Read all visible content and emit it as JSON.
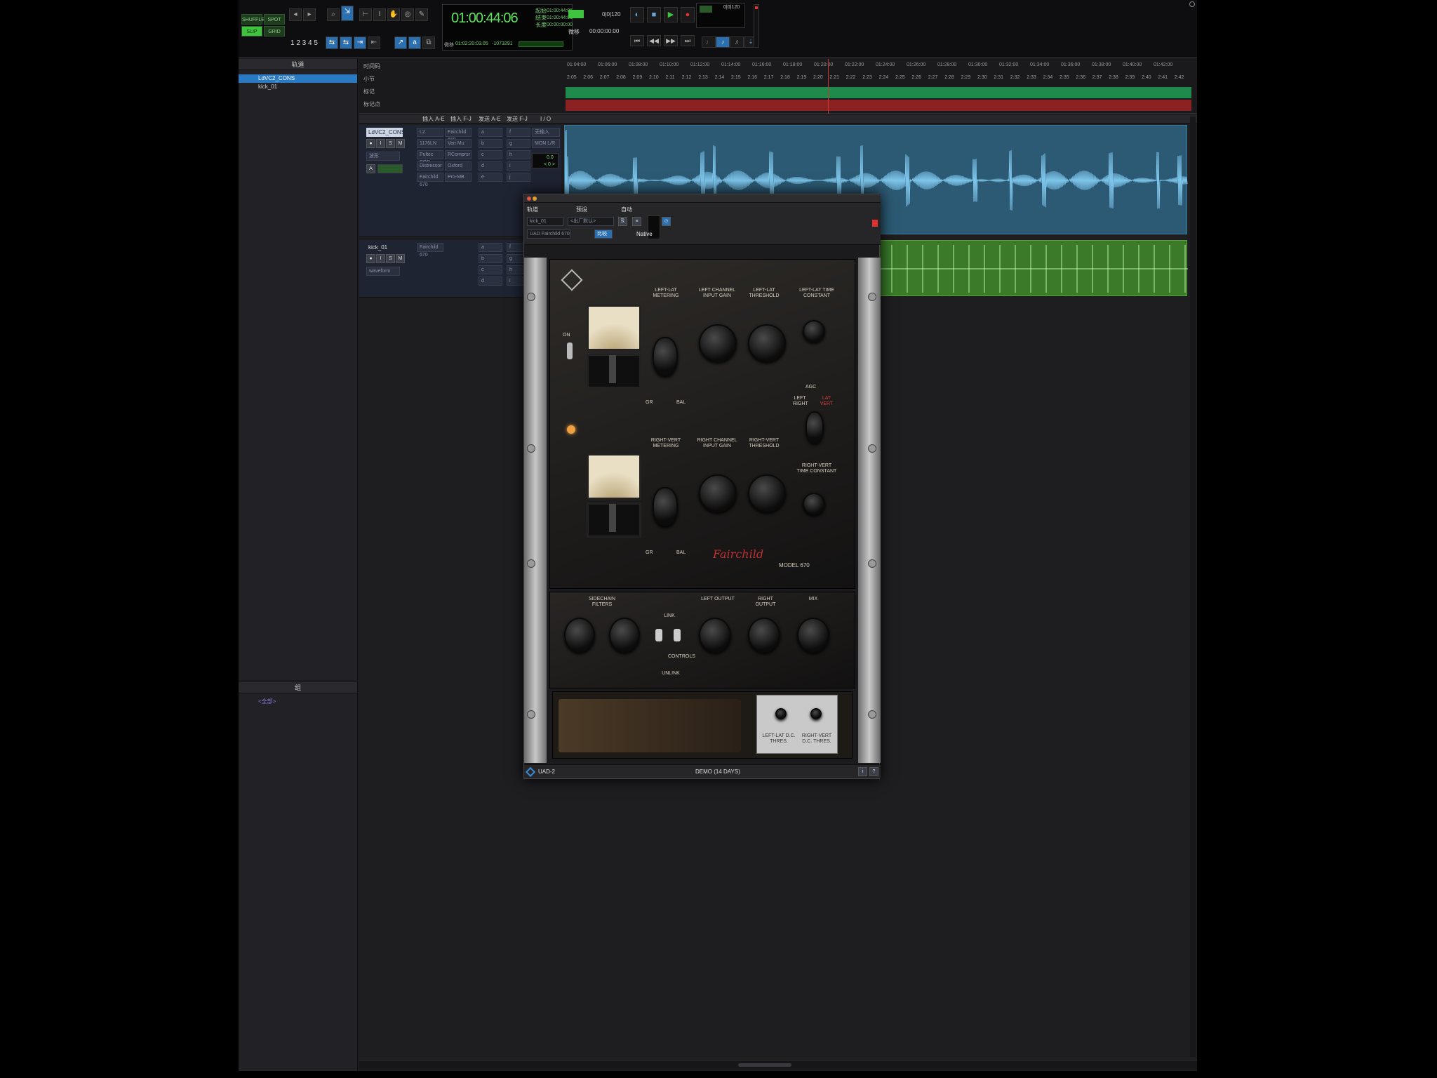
{
  "toolbar": {
    "modes": [
      "SHUFFLE",
      "SPOT",
      "SLIP",
      "GRID"
    ],
    "zoom_presets": "1 2 3 4 5",
    "main_counter": "01:00:44:06",
    "sub_counter": "01:00:44:06",
    "start_end_length": [
      "起始",
      "结束",
      "长度"
    ],
    "start_value": "01:00:44:06",
    "end_value": "01:00:44:06",
    "length_value": "00:00:00:00",
    "nudge_label": "微移",
    "nudge_value": "01:02:20:03.05",
    "cursor_value": "-1073291",
    "grid_value": "0|0|120",
    "transport_counter": "0|0|120"
  },
  "tracks_panel": {
    "title": "轨道",
    "items": [
      {
        "name": "LdVC2_CONS",
        "selected": true
      },
      {
        "name": "kick_01",
        "selected": false
      }
    ]
  },
  "groups_panel": {
    "title": "组",
    "items": [
      "<全部>"
    ]
  },
  "rulers": {
    "labels": [
      "时间码",
      "小节",
      "标记",
      "标记点"
    ],
    "timecodes": [
      "01:04:00",
      "01:06:00",
      "01:08:00",
      "01:10:00",
      "01:12:00",
      "01:14:00",
      "01:16:00",
      "01:18:00",
      "01:20:00",
      "01:22:00",
      "01:24:00",
      "01:26:00",
      "01:28:00",
      "01:30:00",
      "01:32:00",
      "01:34:00",
      "01:36:00",
      "01:38:00",
      "01:40:00",
      "01:42:00"
    ],
    "bars": [
      "2:05",
      "2:06",
      "2:07",
      "2:08",
      "2:09",
      "2:10",
      "2:11",
      "2:12",
      "2:13",
      "2:14",
      "2:15",
      "2:16",
      "2:17",
      "2:18",
      "2:19",
      "2:20",
      "2:21",
      "2:22",
      "2:23",
      "2:24",
      "2:25",
      "2:26",
      "2:27",
      "2:28",
      "2:29",
      "2:30",
      "2:31",
      "2:32",
      "2:33",
      "2:34",
      "2:35",
      "2:36",
      "2:37",
      "2:38",
      "2:39",
      "2:40",
      "2:41",
      "2:42"
    ]
  },
  "columns": [
    "插入 A-E",
    "插入 F-J",
    "发送 A-E",
    "发送 F-J",
    "I / O"
  ],
  "track1": {
    "name": "LdVC2_CONS",
    "view": "波形",
    "inserts": [
      "L2",
      "1176LN",
      "Pultec EQP",
      "Distressor",
      "Fairchild 670"
    ],
    "inserts_fj": [
      "Fairchild 660",
      "Vari Mu",
      "RComprsr",
      "Oxford",
      "Pro-MB"
    ],
    "sends": [
      "a",
      "b",
      "c",
      "d",
      "e"
    ],
    "sends_fj": [
      "f",
      "g",
      "h",
      "i",
      "j"
    ],
    "io_in": "无输入",
    "io_out": "MON L/R",
    "vol": "0.0",
    "pan": "< 0 >"
  },
  "track2": {
    "name": "kick_01",
    "view": "waveform",
    "inserts": [
      "Fairchild 670"
    ],
    "sends": [
      "a",
      "b",
      "c",
      "d"
    ],
    "sends_fj": [
      "f",
      "g",
      "h",
      "i"
    ]
  },
  "plugin": {
    "title_row": [
      "轨道",
      "预设",
      "自动"
    ],
    "track_select": "kick_01",
    "preset": "<出厂默认>",
    "insert_name": "UAD Fairchild 670",
    "compare": "比较",
    "native": "Native",
    "panel": {
      "top_labels": [
        "LEFT-LAT METERING",
        "LEFT CHANNEL INPUT GAIN",
        "LEFT-LAT THRESHOLD",
        "LEFT-LAT TIME CONSTANT"
      ],
      "mid_labels": [
        "RIGHT-VERT METERING",
        "RIGHT CHANNEL INPUT GAIN",
        "RIGHT-VERT THRESHOLD",
        "RIGHT-VERT TIME CONSTANT"
      ],
      "agc": "AGC",
      "agc_left": "LEFT RIGHT",
      "agc_right": "LAT VERT",
      "on": "ON",
      "gr": "GR",
      "bal": "BAL",
      "brand": "Fairchild",
      "model": "MODEL 670",
      "lower_labels": [
        "SIDECHAIN FILTERS",
        "LEFT OUTPUT",
        "RIGHT OUTPUT",
        "MIX"
      ],
      "link": "LINK",
      "controls": "CONTROLS",
      "unlink": "UNLINK",
      "dc_labels": [
        "LEFT-LAT D.C. THRES.",
        "RIGHT-VERT D.C. THRES."
      ]
    },
    "footer_brand": "UAD-2",
    "footer_status": "DEMO (14 DAYS)"
  },
  "colors": {
    "clip_blue": "#2c5a74",
    "clip_green": "#3a7a28",
    "counter_green": "#5fe35f",
    "selection_blue": "#2b7bc4"
  }
}
